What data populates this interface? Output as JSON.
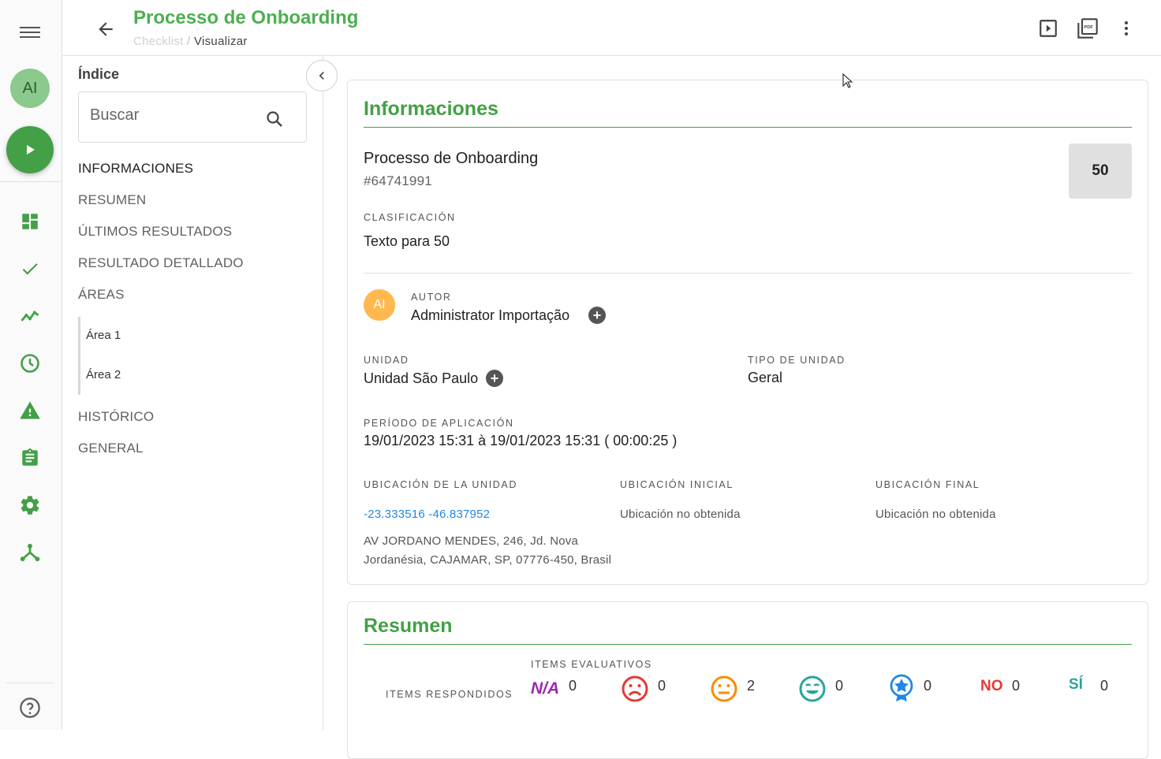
{
  "rail": {
    "avatar_initials": "AI",
    "icons": [
      "dashboard-icon",
      "check-icon",
      "trending-icon",
      "clock-icon",
      "warning-icon",
      "clipboard-icon",
      "gear-icon",
      "hierarchy-icon"
    ],
    "help_icon": "help-icon"
  },
  "header": {
    "title": "Processo de Onboarding",
    "breadcrumb_1": "Checklist",
    "breadcrumb_sep": "/",
    "breadcrumb_2": "Visualizar",
    "actions": [
      "play-icon",
      "pdf-icon",
      "more-vert-icon"
    ]
  },
  "sidebar": {
    "title": "Índice",
    "search_placeholder": "Buscar",
    "items": [
      {
        "label": "INFORMACIONES"
      },
      {
        "label": "RESUMEN"
      },
      {
        "label": "ÚLTIMOS RESULTADOS"
      },
      {
        "label": "RESULTADO DETALLADO"
      },
      {
        "label": "ÁREAS"
      },
      {
        "label": "HISTÓRICO"
      },
      {
        "label": "GENERAL"
      }
    ],
    "sub_items": [
      {
        "label": "Área 1"
      },
      {
        "label": "Área 2"
      }
    ]
  },
  "info": {
    "section_title": "Informaciones",
    "checklist_name": "Processo de Onboarding",
    "checklist_id": "#64741991",
    "score": "50",
    "classification_label": "CLASIFICACIÓN",
    "classification_value": "Texto para 50",
    "author_initials": "AI",
    "author_label": "AUTOR",
    "author_value": "Administrator Importação",
    "unit_label": "UNIDAD",
    "unit_value": "Unidad São Paulo",
    "unit_type_label": "TIPO DE UNIDAD",
    "unit_type_value": "Geral",
    "period_label": "PERÍODO DE APLICACIÓN",
    "period_value": "19/01/2023 15:31 à 19/01/2023 15:31 ( 00:00:25 )",
    "unit_location_label": "UBICACIÓN DE LA UNIDAD",
    "unit_location_coords": "-23.333516 -46.837952",
    "address_line1": "AV JORDANO MENDES, 246, Jd. Nova",
    "address_line2": "Jordanésia, CAJAMAR, SP, 07776-450, Brasil",
    "initial_location_label": "UBICACIÓN INICIAL",
    "initial_location_value": "Ubicación no obtenida",
    "final_location_label": "UBICACIÓN FINAL",
    "final_location_value": "Ubicación no obtenida"
  },
  "summary": {
    "section_title": "Resumen",
    "answered_label": "ITEMS RESPONDIDOS",
    "evaluative_label": "ITEMS EVALUATIVOS",
    "na_label": "N/A",
    "no_label": "NO",
    "yes_label": "SÍ",
    "counts": {
      "na": "0",
      "sad": "0",
      "neutral": "2",
      "happy": "0",
      "star": "0",
      "no": "0",
      "yes": "0"
    },
    "colors": {
      "na": "#9c27b0",
      "sad": "#e53935",
      "neutral": "#fb8c00",
      "happy": "#26a69a",
      "star": "#1e88e5",
      "no": "#e53935",
      "yes": "#26a69a"
    }
  },
  "colors": {
    "accent": "#43a047",
    "link": "#1e88e5"
  }
}
